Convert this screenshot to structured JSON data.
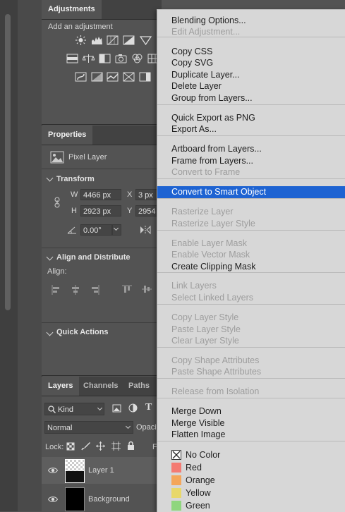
{
  "colors": {
    "menu_bg": "#d7d7d7",
    "highlight": "#1e63d2",
    "panel_bg": "#535353"
  },
  "adjustments": {
    "tab": "Adjustments",
    "add_label": "Add an adjustment"
  },
  "properties": {
    "tab": "Properties",
    "layer_type": "Pixel Layer",
    "transform_header": "Transform",
    "w_label": "W",
    "w_value": "4466 px",
    "x_label": "X",
    "x_value": "3 px",
    "h_label": "H",
    "h_value": "2923 px",
    "y_label": "Y",
    "y_value": "2954",
    "angle_value": "0.00°",
    "align_header": "Align and Distribute",
    "align_label": "Align:",
    "quick_header": "Quick Actions"
  },
  "layers_panel": {
    "tabs": [
      "Layers",
      "Channels",
      "Paths"
    ],
    "kind_label": "Kind",
    "blend_mode": "Normal",
    "opacity_label": "Opacit",
    "lock_label": "Lock:",
    "fill_label": "F",
    "layers": [
      {
        "name": "Layer 1"
      },
      {
        "name": "Background"
      }
    ]
  },
  "menu": {
    "groups": [
      [
        {
          "label": "Blending Options...",
          "enabled": true
        },
        {
          "label": "Edit Adjustment...",
          "enabled": false
        }
      ],
      [
        {
          "label": "Copy CSS",
          "enabled": true
        },
        {
          "label": "Copy SVG",
          "enabled": true
        },
        {
          "label": "Duplicate Layer...",
          "enabled": true
        },
        {
          "label": "Delete Layer",
          "enabled": true
        },
        {
          "label": "Group from Layers...",
          "enabled": true
        }
      ],
      [
        {
          "label": "Quick Export as PNG",
          "enabled": true
        },
        {
          "label": "Export As...",
          "enabled": true
        }
      ],
      [
        {
          "label": "Artboard from Layers...",
          "enabled": true
        },
        {
          "label": "Frame from Layers...",
          "enabled": true
        },
        {
          "label": "Convert to Frame",
          "enabled": false
        }
      ],
      [
        {
          "label": "Convert to Smart Object",
          "enabled": true,
          "selected": true
        }
      ],
      [
        {
          "label": "Rasterize Layer",
          "enabled": false
        },
        {
          "label": "Rasterize Layer Style",
          "enabled": false
        }
      ],
      [
        {
          "label": "Enable Layer Mask",
          "enabled": false
        },
        {
          "label": "Enable Vector Mask",
          "enabled": false
        },
        {
          "label": "Create Clipping Mask",
          "enabled": true
        }
      ],
      [
        {
          "label": "Link Layers",
          "enabled": false
        },
        {
          "label": "Select Linked Layers",
          "enabled": false
        }
      ],
      [
        {
          "label": "Copy Layer Style",
          "enabled": false
        },
        {
          "label": "Paste Layer Style",
          "enabled": false
        },
        {
          "label": "Clear Layer Style",
          "enabled": false
        }
      ],
      [
        {
          "label": "Copy Shape Attributes",
          "enabled": false
        },
        {
          "label": "Paste Shape Attributes",
          "enabled": false
        }
      ],
      [
        {
          "label": "Release from Isolation",
          "enabled": false
        }
      ],
      [
        {
          "label": "Merge Down",
          "enabled": true
        },
        {
          "label": "Merge Visible",
          "enabled": true
        },
        {
          "label": "Flatten Image",
          "enabled": true
        }
      ]
    ],
    "color_labels": [
      {
        "label": "No Color",
        "color": "none"
      },
      {
        "label": "Red",
        "color": "#f47b73"
      },
      {
        "label": "Orange",
        "color": "#f4a65a"
      },
      {
        "label": "Yellow",
        "color": "#e8d86a"
      },
      {
        "label": "Green",
        "color": "#8fd67e"
      }
    ]
  }
}
